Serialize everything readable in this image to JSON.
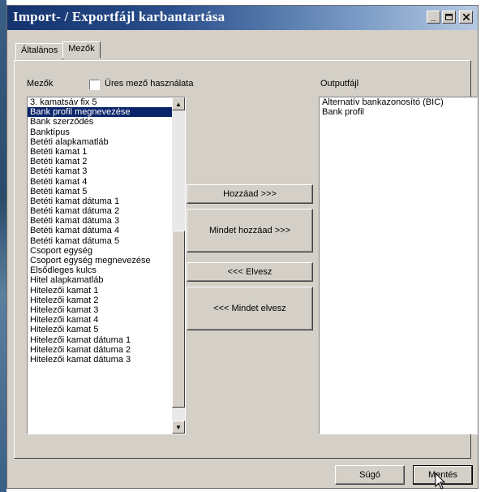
{
  "window": {
    "title": "Import- / Exportfájl karbantartása",
    "min_icon": "minimize-icon",
    "max_icon": "maximize-icon",
    "close_icon": "close-icon"
  },
  "tabs": [
    {
      "label": "Általános"
    },
    {
      "label": "Mezők"
    }
  ],
  "fields_label": "Mezők",
  "empty_field_checkbox": {
    "label": "Üres mező használata",
    "checked": false
  },
  "output_label": "Outputfájl",
  "left_list": [
    "3. kamatsáv fix 5",
    "Bank profil megnevezése",
    "Bank szerződés",
    "Banktípus",
    "Betéti alapkamatláb",
    "Betéti kamat 1",
    "Betéti kamat 2",
    "Betéti kamat 3",
    "Betéti kamat 4",
    "Betéti kamat 5",
    "Betéti kamat dátuma 1",
    "Betéti kamat dátuma 2",
    "Betéti kamat dátuma 3",
    "Betéti kamat dátuma 4",
    "Betéti kamat dátuma 5",
    "Csoport egység",
    "Csoport egység megnevezése",
    "Elsődleges kulcs",
    "Hitel alapkamatláb",
    "Hitelezői kamat 1",
    "Hitelezői kamat 2",
    "Hitelezői kamat 3",
    "Hitelezői kamat 4",
    "Hitelezői kamat 5",
    "Hitelezői kamat dátuma 1",
    "Hitelezői kamat dátuma 2",
    "Hitelezői kamat dátuma 3"
  ],
  "left_list_selected": "Bank profil megnevezése",
  "right_list": [
    "Alternatív bankazonosító (BIC)",
    "Bank profil"
  ],
  "buttons": {
    "add": "Hozzáad >>>",
    "add_all": "Mindet hozzáad >>>",
    "remove": "<<< Elvesz",
    "remove_all": "<<< Mindet elvesz",
    "help": "Súgó",
    "save": "Mentés"
  },
  "colors": {
    "selection": "#0a246a",
    "title_start": "#14336e",
    "title_end": "#b6c9e2",
    "face": "#d4d0c8"
  }
}
